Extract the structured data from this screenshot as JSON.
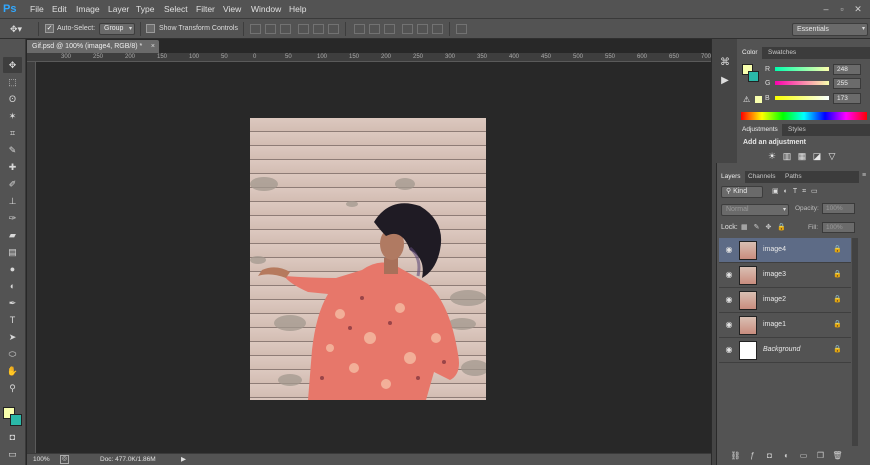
{
  "app": {
    "logo": "Ps"
  },
  "menu": [
    "File",
    "Edit",
    "Image",
    "Layer",
    "Type",
    "Select",
    "Filter",
    "View",
    "Window",
    "Help"
  ],
  "window_controls": [
    "–",
    "▫",
    "✕"
  ],
  "options": {
    "auto_select_label": "Auto-Select:",
    "auto_select_checked": true,
    "group_value": "Group",
    "show_transform_label": "Show Transform Controls",
    "show_transform_checked": false,
    "workspace": "Essentials"
  },
  "document": {
    "tab_title": "Gif.psd @ 100% (image4, RGB/8) *",
    "tab_close": "×",
    "ruler_marks": [
      "300",
      "250",
      "200",
      "150",
      "100",
      "50",
      "0",
      "50",
      "100",
      "150",
      "200",
      "250",
      "300",
      "350",
      "400",
      "450",
      "500",
      "550",
      "600",
      "650",
      "700"
    ],
    "zoom": "100%",
    "doc_info": "Doc: 477.0K/1.86M"
  },
  "colors": {
    "foreground": "#f8ffad",
    "background": "#2ab8a8"
  },
  "color_panel": {
    "tabs": [
      "Color",
      "Swatches"
    ],
    "r_label": "R",
    "g_label": "G",
    "b_label": "B",
    "r": "248",
    "g": "255",
    "b": "173"
  },
  "adjustments_panel": {
    "tabs": [
      "Adjustments",
      "Styles"
    ],
    "heading": "Add an adjustment",
    "icons": [
      "brightness-icon",
      "levels-icon",
      "curves-icon",
      "exposure-icon",
      "gradient-map-icon"
    ]
  },
  "layers_panel": {
    "tabs": [
      "Layers",
      "Channels",
      "Paths"
    ],
    "kind_value": "Kind",
    "blend_mode": "Normal",
    "opacity_label": "Opacity:",
    "opacity_value": "100%",
    "lock_label": "Lock:",
    "fill_label": "Fill:",
    "fill_value": "100%",
    "layers": [
      {
        "name": "image4",
        "selected": true
      },
      {
        "name": "image3",
        "selected": false
      },
      {
        "name": "image2",
        "selected": false
      },
      {
        "name": "image1",
        "selected": false
      },
      {
        "name": "Background",
        "selected": false
      }
    ]
  }
}
